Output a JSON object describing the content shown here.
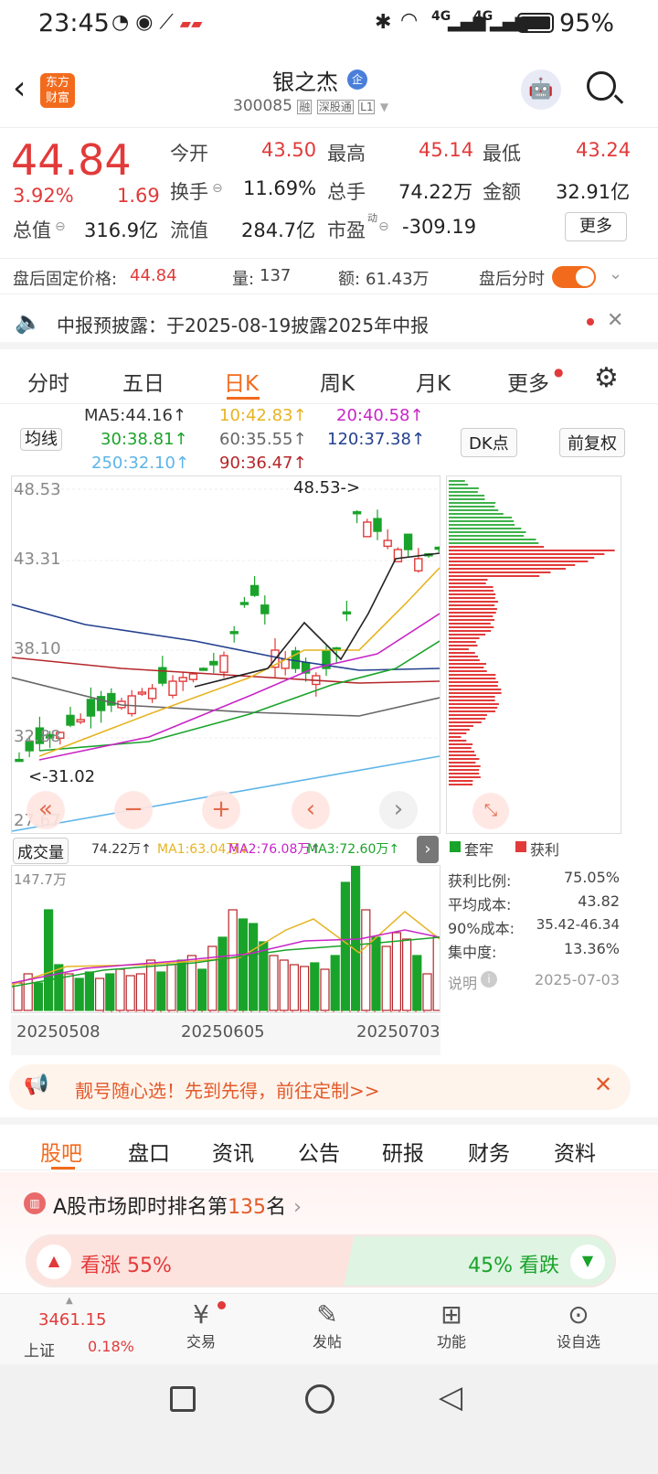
{
  "status": {
    "time": "23:45",
    "battery": "95%",
    "net1": "4G",
    "net2": "4G"
  },
  "header": {
    "logo_line1": "东方",
    "logo_line2": "财富",
    "stock_name": "银之杰",
    "stock_badge": "企",
    "code": "300085",
    "tag1": "融",
    "tag2": "深股通",
    "tag3": "L1"
  },
  "quote": {
    "price": "44.84",
    "pct": "3.92%",
    "change": "1.69",
    "open_label": "今开",
    "open": "43.50",
    "high_label": "最高",
    "high": "45.14",
    "low_label": "最低",
    "low": "43.24",
    "turnover_label": "换手",
    "turnover": "11.69%",
    "vol_label": "总手",
    "vol": "74.22万",
    "amt_label": "金额",
    "amt": "32.91亿",
    "mcap_label": "总值",
    "mcap": "316.9亿",
    "float_label": "流值",
    "float": "284.7亿",
    "pe_label": "市盈",
    "pe_sup": "动",
    "pe": "-309.19",
    "more": "更多"
  },
  "afterhours": {
    "price_label": "盘后固定价格:",
    "price": "44.84",
    "vol_label": "量:",
    "vol": "137",
    "amt_label": "额:",
    "amt": "61.43万",
    "toggle_label": "盘后分时"
  },
  "notice": {
    "text": "中报预披露：于2025-08-19披露2025年中报"
  },
  "chart_tabs": [
    "分时",
    "五日",
    "日K",
    "周K",
    "月K",
    "更多"
  ],
  "ma": {
    "ma5": "MA5:44.16↑",
    "ma10": "10:42.83↑",
    "ma20": "20:40.58↑",
    "ma30": "30:38.81↑",
    "ma60": "60:35.55↑",
    "ma120": "120:37.38↑",
    "ma250": "250:32.10↑",
    "ma90": "90:36.47↑",
    "selector": "均线",
    "dk": "DK点",
    "fq": "前复权"
  },
  "kline": {
    "y_labels": [
      "48.53",
      "43.31",
      "38.10",
      "32.88",
      "27.67"
    ],
    "max_label": "48.53->",
    "min_label": "<-31.02"
  },
  "volume": {
    "selector": "成交量",
    "value": "74.22万↑",
    "ma1": "MA1:63.04万↓",
    "ma2": "MA2:76.08万↑",
    "ma3": "MA3:72.60万↑",
    "ymax": "147.7万",
    "dates": [
      "20250508",
      "20250605",
      "20250703"
    ]
  },
  "chip_legend": {
    "trapped": "套牢",
    "profit": "获利"
  },
  "chip_stats": [
    {
      "label": "获利比例:",
      "value": "75.05%"
    },
    {
      "label": "平均成本:",
      "value": "43.82"
    },
    {
      "label": "90%成本:",
      "value": "35.42-46.34"
    },
    {
      "label": "集中度:",
      "value": "13.36%"
    }
  ],
  "chip_note": {
    "label": "说明",
    "date": "2025-07-03"
  },
  "ad": {
    "text": "靓号随心选！先到先得，前往定制>>"
  },
  "section_tabs": [
    "股吧",
    "盘口",
    "资讯",
    "公告",
    "研报",
    "财务",
    "资料"
  ],
  "rank": {
    "prefix": "A股市场即时排名第",
    "num": "135",
    "suffix": "名"
  },
  "vote": {
    "up": "看涨 55%",
    "down": "45% 看跌",
    "up_pct": 0.55
  },
  "bottom_nav": {
    "index_value": "3461.15",
    "index_name": "上证",
    "index_pct": "0.18%",
    "trade": "交易",
    "post": "发帖",
    "func": "功能",
    "watch": "设自选"
  },
  "colors": {
    "up": "#e23a3a",
    "down": "#1aa32a",
    "accent": "#f26b1d"
  }
}
